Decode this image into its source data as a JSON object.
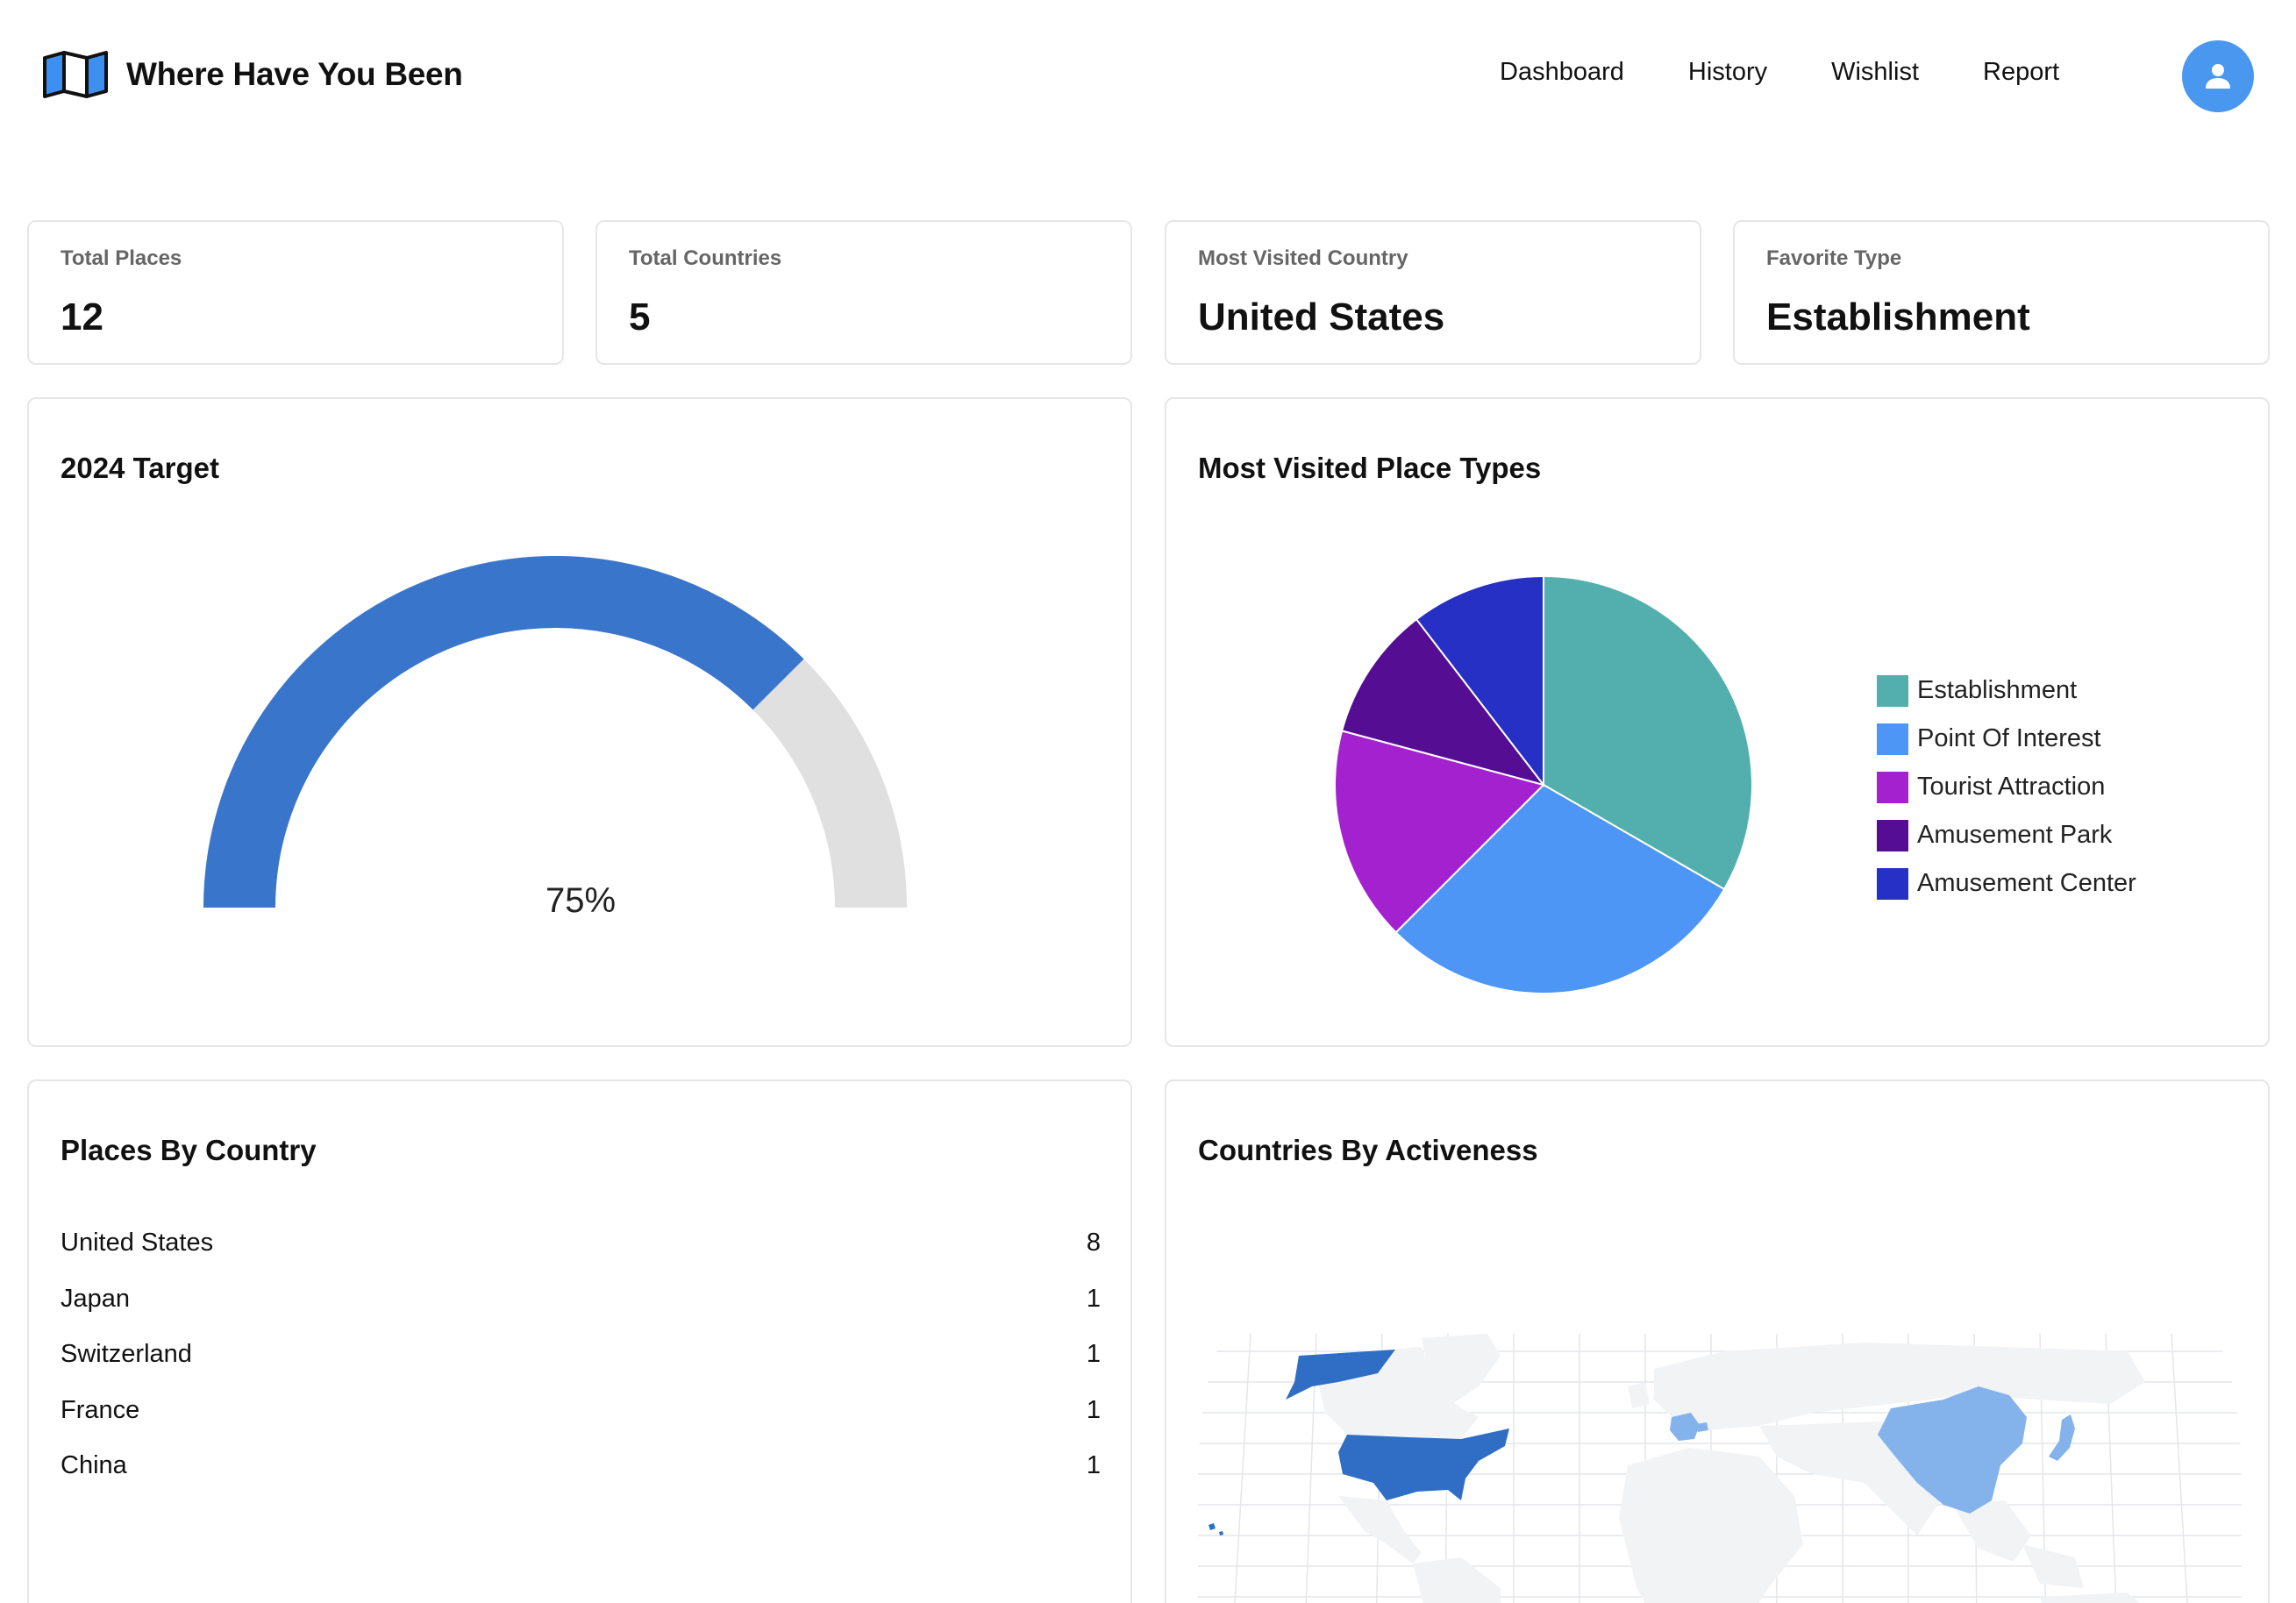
{
  "app": {
    "title": "Where Have You Been",
    "nav": [
      {
        "label": "Dashboard"
      },
      {
        "label": "History"
      },
      {
        "label": "Wishlist"
      },
      {
        "label": "Report"
      }
    ]
  },
  "stats": [
    {
      "label": "Total Places",
      "value": "12"
    },
    {
      "label": "Total Countries",
      "value": "5"
    },
    {
      "label": "Most Visited Country",
      "value": "United States"
    },
    {
      "label": "Favorite Type",
      "value": "Establishment"
    }
  ],
  "target": {
    "title": "2024 Target",
    "percent_label": "75%",
    "progress_fraction": 0.75,
    "fill_color": "#3a75cc",
    "track_color": "#e0e0e0"
  },
  "place_types": {
    "title": "Most Visited Place Types",
    "chart_data": {
      "type": "pie",
      "categories": [
        "Establishment",
        "Point Of Interest",
        "Tourist Attraction",
        "Amusement Park",
        "Amusement Center"
      ],
      "values": [
        4,
        3.5,
        2,
        1.25,
        1.25
      ],
      "colors": [
        "#53afae",
        "#4d96f5",
        "#a421d0",
        "#540d93",
        "#2730c4"
      ],
      "legend": "right"
    }
  },
  "countries": {
    "title": "Places By Country",
    "rows": [
      {
        "name": "United States",
        "count": "8"
      },
      {
        "name": "Japan",
        "count": "1"
      },
      {
        "name": "Switzerland",
        "count": "1"
      },
      {
        "name": "France",
        "count": "1"
      },
      {
        "name": "China",
        "count": "1"
      }
    ]
  },
  "activeness": {
    "title": "Countries By Activeness",
    "colors": {
      "high": "#2f6ec4",
      "low": "#84b3ec",
      "none": "#f2f3f5",
      "grid": "#e4e6ea"
    }
  }
}
